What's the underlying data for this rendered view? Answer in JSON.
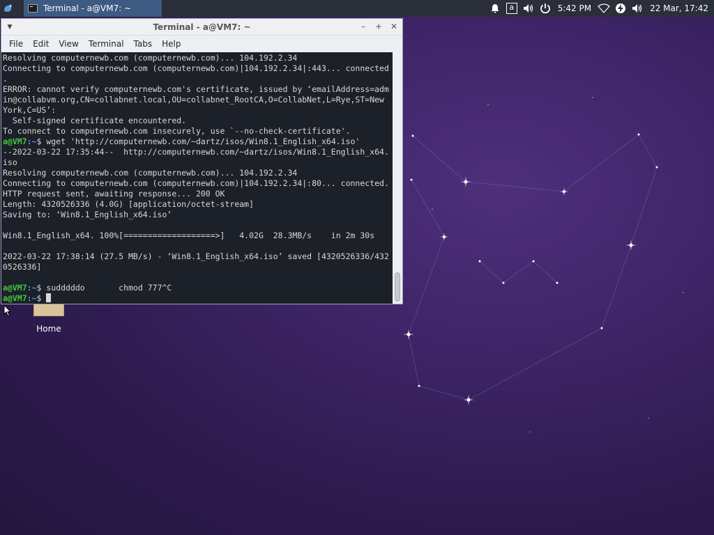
{
  "panel": {
    "task_title": "Terminal - a@VM7: ~",
    "time": "5:42 PM",
    "date": "22 Mar, 17:42",
    "keyboard_layout": "a"
  },
  "window": {
    "title": "Terminal - a@VM7: ~",
    "menu": [
      "File",
      "Edit",
      "View",
      "Terminal",
      "Tabs",
      "Help"
    ]
  },
  "desktop": {
    "home_label": "Home"
  },
  "terminal": {
    "lines": [
      {
        "text": "Resolving computernewb.com (computernewb.com)... 104.192.2.34"
      },
      {
        "text": "Connecting to computernewb.com (computernewb.com)|104.192.2.34|:443... connected"
      },
      {
        "text": "."
      },
      {
        "text": "ERROR: cannot verify computernewb.com's certificate, issued by ‘emailAddress=adm"
      },
      {
        "text": "in@collabvm.org,CN=collabnet.local,OU=collabnet_RootCA,O=CollabNet,L=Rye,ST=New"
      },
      {
        "text": "York,C=US’:"
      },
      {
        "text": "  Self-signed certificate encountered."
      },
      {
        "text": "To connect to computernewb.com insecurely, use `--no-check-certificate'."
      },
      {
        "user": "a@VM7",
        "path": ":~",
        "text": "$ wget 'http://computernewb.com/~dartz/isos/Win8.1_English_x64.iso'"
      },
      {
        "text": "--2022-03-22 17:35:44--  http://computernewb.com/~dartz/isos/Win8.1_English_x64."
      },
      {
        "text": "iso"
      },
      {
        "text": "Resolving computernewb.com (computernewb.com)... 104.192.2.34"
      },
      {
        "text": "Connecting to computernewb.com (computernewb.com)|104.192.2.34|:80... connected."
      },
      {
        "text": "HTTP request sent, awaiting response... 200 OK"
      },
      {
        "text": "Length: 4320526336 (4.0G) [application/octet-stream]"
      },
      {
        "text": "Saving to: ‘Win8.1_English_x64.iso’"
      },
      {
        "text": ""
      },
      {
        "text": "Win8.1_English_x64. 100%[===================>]   4.02G  28.3MB/s    in 2m 30s"
      },
      {
        "text": ""
      },
      {
        "text": "2022-03-22 17:38:14 (27.5 MB/s) - ‘Win8.1_English_x64.iso’ saved [4320526336/432"
      },
      {
        "text": "0526336]"
      },
      {
        "text": ""
      },
      {
        "user": "a@VM7",
        "path": ":~",
        "text": "$ sudddddo       chmod 777^C"
      },
      {
        "user": "a@VM7",
        "path": ":~",
        "text": "$ ",
        "cursor": true
      }
    ]
  }
}
